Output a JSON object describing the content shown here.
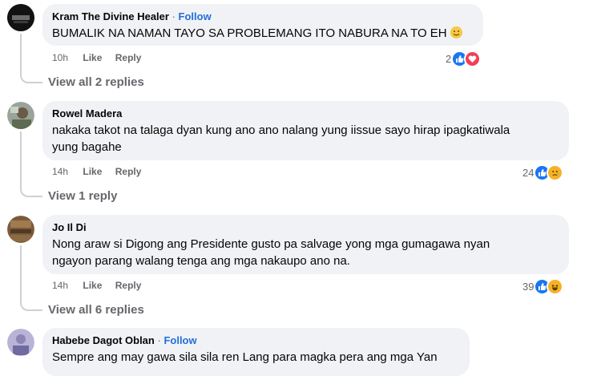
{
  "comments": [
    {
      "author": "Kram The Divine Healer",
      "follow": "Follow",
      "text": "BUMALIK NA NAMAN TAYO SA PROBLEMANG ITO NABURA NA TO EH",
      "time": "10h",
      "like": "Like",
      "reply": "Reply",
      "reaction_count": "2",
      "reactions": [
        "like-icon",
        "love-icon"
      ],
      "view_replies": "View all 2 replies"
    },
    {
      "author": "Rowel Madera",
      "text_line1": "nakaka takot na talaga dyan kung ano ano nalang yung iissue sayo hirap ipagkatiwala",
      "text_line2": "yung bagahe",
      "time": "14h",
      "like": "Like",
      "reply": "Reply",
      "reaction_count": "24",
      "reactions": [
        "like-icon",
        "sad-icon"
      ],
      "view_replies": "View 1 reply"
    },
    {
      "author": "Jo Il Di",
      "text_line1": "Nong araw si Digong ang Presidente gusto pa salvage yong mga gumagawa nyan",
      "text_line2": "ngayon parang walang tenga ang mga nakaupo ano na.",
      "time": "14h",
      "like": "Like",
      "reply": "Reply",
      "reaction_count": "39",
      "reactions": [
        "like-icon",
        "haha-icon"
      ],
      "view_replies": "View all 6 replies"
    },
    {
      "author": "Habebe Dagot Oblan",
      "follow": "Follow",
      "text": "Sempre ang may gawa sila sila ren Lang para magka pera ang mga Yan"
    }
  ],
  "colors": {
    "bubble": "#f0f2f5",
    "follow": "#216fdb",
    "like": "#1877f2",
    "love": "#f33e58",
    "emoji": "#f7b125"
  }
}
